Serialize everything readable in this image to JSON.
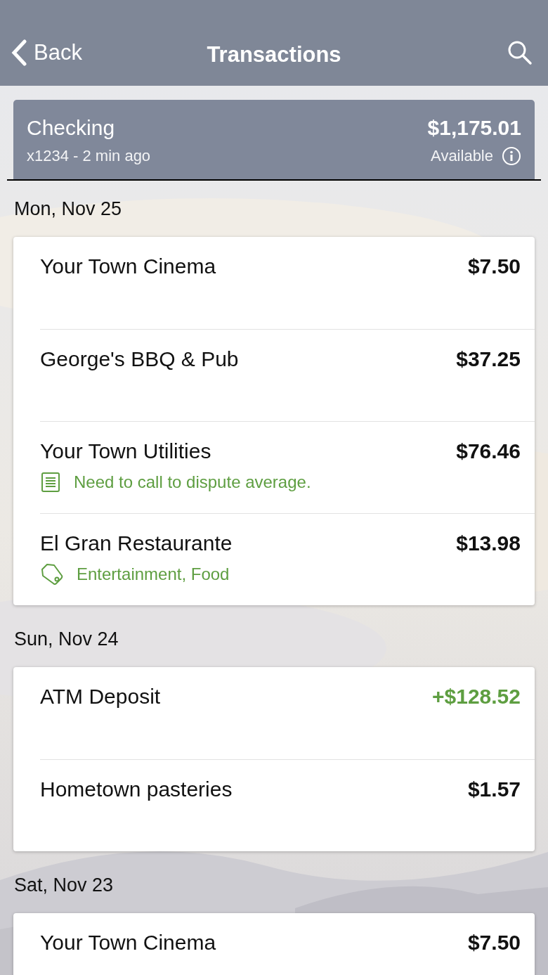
{
  "nav_bar": {
    "back": "Back",
    "title": "Transactions"
  },
  "account": {
    "name": "Checking",
    "detail": "x1234 - 2 min ago",
    "balance": "$1,175.01",
    "balance_label": "Available"
  },
  "groups": [
    {
      "date": "Mon, Nov 25",
      "transactions": [
        {
          "name": "Your Town Cinema",
          "amount": "$7.50",
          "kind": "debit"
        },
        {
          "name": "George's BBQ & Pub",
          "amount": "$37.25",
          "kind": "debit"
        },
        {
          "name": "Your Town Utilities",
          "amount": "$76.46",
          "kind": "debit",
          "detail": {
            "kind": "note",
            "text": "Need to call to dispute average."
          }
        },
        {
          "name": "El Gran Restaurante",
          "amount": "$13.98",
          "kind": "debit",
          "detail": {
            "kind": "tags",
            "text": "Entertainment, Food"
          }
        }
      ]
    },
    {
      "date": "Sun, Nov 24",
      "transactions": [
        {
          "name": "ATM Deposit",
          "amount": "+$128.52",
          "kind": "credit"
        },
        {
          "name": "Hometown pasteries",
          "amount": "$1.57",
          "kind": "debit"
        }
      ]
    },
    {
      "date": "Sat, Nov 23",
      "transactions": [
        {
          "name": "Your Town Cinema",
          "amount": "$7.50",
          "kind": "debit"
        }
      ]
    }
  ]
}
